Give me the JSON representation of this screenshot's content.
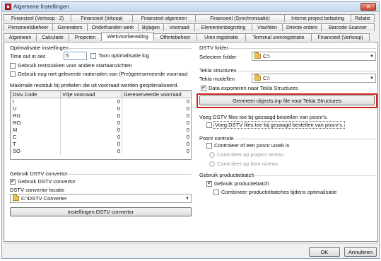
{
  "window": {
    "title": "Algemene Instellingen",
    "close_label": "✕"
  },
  "tabs": {
    "row1": [
      "Financieel (Verkoop - 2)",
      "Financieel (Inkoop)",
      "Financieel algemeen",
      "Financieel (Synchronisatie)",
      "Interne project belasting",
      "Relatie"
    ],
    "row2": [
      "Personeelsbeheer",
      "Generators",
      "Onderhanden werk",
      "Bijlagen",
      "Voorraad",
      "Elementenbegroting",
      "Vrachten",
      "Directe orders",
      "Barcode Scanner"
    ],
    "row3": [
      "Algemeen",
      "Calculatie",
      "Projecten",
      "Werkvoorbereiding",
      "Offertebeheer",
      "Uren registratie",
      "Terminal urenregistratie",
      "Financieel (Verkoop)"
    ],
    "active": "Werkvoorbereiding"
  },
  "optimalisatie": {
    "title": "Optimalisatie instellingen",
    "timeout_label": "Time out in sec",
    "timeout_value": "5",
    "toon_log_label": "Toon optimalisatie log",
    "reststuk_label": "Gebruik reststukken voor andere startaanzichten",
    "niet_geleverd_label": "Gebruik nog niet geleverde materialen van (Pre)gereserveerde voorraad"
  },
  "reststuk": {
    "title": "Maximale reststuk bij profielen die uit voorraad worden geoptimaliseerd.",
    "columns": [
      "Dsiv Code",
      "Vrije voorraad",
      "Gereserveerde voorraad"
    ],
    "rows": [
      [
        "I",
        "0",
        "0"
      ],
      [
        "U",
        "0",
        "0"
      ],
      [
        "RU",
        "0",
        "0"
      ],
      [
        "RO",
        "0",
        "0"
      ],
      [
        "M",
        "0",
        "0"
      ],
      [
        "C",
        "0",
        "0"
      ],
      [
        "T",
        "0",
        "0"
      ],
      [
        "SO",
        "0",
        "0"
      ]
    ]
  },
  "dstv_convertor": {
    "title": "Gebruik DSTV convertor",
    "use_label": "Gebruik DSTV convertor",
    "use_checked": "✔",
    "locatie_label": "DSTV convertor locatie",
    "locatie_value": "C:\\DSTV Converter",
    "settings_button": "Instellingen DSTV convertor"
  },
  "dstv_folder": {
    "title": "DSTV folder",
    "select_label": "Selecteer folder",
    "select_value": "C:\\"
  },
  "tekla": {
    "title": "Tekla structures",
    "models_label": "Tekla modellen",
    "models_value": "C:\\",
    "export_label": "Data exporteren naar Tekla Structures",
    "export_checked": "✔",
    "generate_button": "Genereer objects.inp file voor Tekla Structures"
  },
  "dstv_posnr": {
    "title": "Voeg DSTV files toe bij gezaagd bestellen van posnr's.",
    "checkbox_label": "Voeg DSTV files toe bij gezaagd bestellen van posnr's."
  },
  "posnr": {
    "title": "Posnr controle",
    "check_label": "Controleer of een posnr uniek is",
    "radio1_label": "Controleer op project niveau",
    "radio2_label": "Controleer op fase niveau"
  },
  "productiebatch": {
    "title": "Gebruik productiebatch",
    "use_label": "Gebruik productiebatch",
    "use_checked": "✔",
    "combine_label": "Combineer productiebatches tijdens optimalisatie"
  },
  "footer": {
    "ok_label": "OK",
    "cancel_label": "Annuleren"
  },
  "icons": {
    "folder": "folder-icon",
    "dropdown": "chevron-down-icon",
    "app": "app-icon"
  },
  "colors": {
    "highlight": "#d01f1f",
    "titlebar": "#c7d8ee"
  }
}
